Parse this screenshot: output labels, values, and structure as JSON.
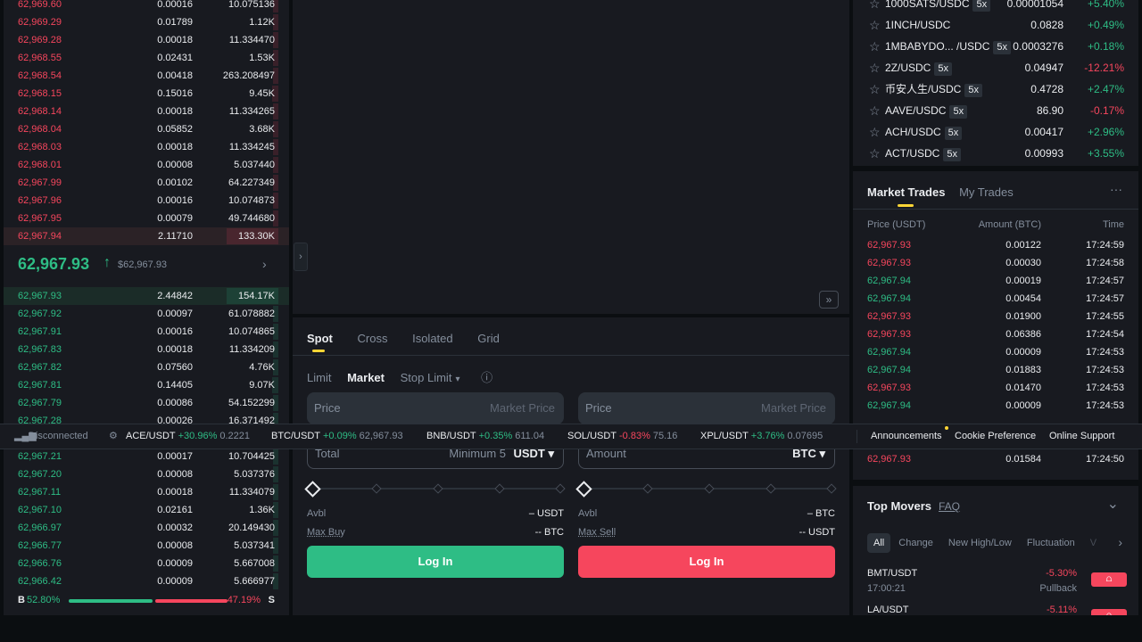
{
  "orderbook": {
    "asks": [
      {
        "price": "62,969.60",
        "amount": "0.00016",
        "total": "10.075136",
        "depth": 0.02
      },
      {
        "price": "62,969.29",
        "amount": "0.01789",
        "total": "1.12K",
        "depth": 0.04
      },
      {
        "price": "62,969.28",
        "amount": "0.00018",
        "total": "11.334470",
        "depth": 0.02
      },
      {
        "price": "62,968.55",
        "amount": "0.02431",
        "total": "1.53K",
        "depth": 0.05
      },
      {
        "price": "62,968.54",
        "amount": "0.00418",
        "total": "263.208497",
        "depth": 0.03
      },
      {
        "price": "62,968.15",
        "amount": "0.15016",
        "total": "9.45K",
        "depth": 0.12
      },
      {
        "price": "62,968.14",
        "amount": "0.00018",
        "total": "11.334265",
        "depth": 0.02
      },
      {
        "price": "62,968.04",
        "amount": "0.05852",
        "total": "3.68K",
        "depth": 0.06
      },
      {
        "price": "62,968.03",
        "amount": "0.00018",
        "total": "11.334245",
        "depth": 0.02
      },
      {
        "price": "62,968.01",
        "amount": "0.00008",
        "total": "5.037440",
        "depth": 0.02
      },
      {
        "price": "62,967.99",
        "amount": "0.00102",
        "total": "64.227349",
        "depth": 0.02
      },
      {
        "price": "62,967.96",
        "amount": "0.00016",
        "total": "10.074873",
        "depth": 0.02
      },
      {
        "price": "62,967.95",
        "amount": "0.00079",
        "total": "49.744680",
        "depth": 0.02
      },
      {
        "price": "62,967.94",
        "amount": "2.11710",
        "total": "133.30K",
        "depth": 1.0
      }
    ],
    "mid_price": "62,967.93",
    "mid_arrow": "↑",
    "mid_sub": "$62,967.93",
    "bids_top": [
      {
        "price": "62,967.93",
        "amount": "2.44842",
        "total": "154.17K",
        "depth": 1.0
      },
      {
        "price": "62,967.92",
        "amount": "0.00097",
        "total": "61.078882",
        "depth": 0.02
      },
      {
        "price": "62,967.91",
        "amount": "0.00016",
        "total": "10.074865",
        "depth": 0.02
      },
      {
        "price": "62,967.83",
        "amount": "0.00018",
        "total": "11.334209",
        "depth": 0.02
      },
      {
        "price": "62,967.82",
        "amount": "0.07560",
        "total": "4.76K",
        "depth": 0.06
      },
      {
        "price": "62,967.81",
        "amount": "0.14405",
        "total": "9.07K",
        "depth": 0.12
      },
      {
        "price": "62,967.79",
        "amount": "0.00086",
        "total": "54.152299",
        "depth": 0.02
      },
      {
        "price": "62,967.28",
        "amount": "0.00026",
        "total": "16.371492",
        "depth": 0.02
      }
    ],
    "bids_bottom": [
      {
        "price": "62,967.21",
        "amount": "0.00017",
        "total": "10.704425",
        "depth": 0.02
      },
      {
        "price": "62,967.20",
        "amount": "0.00008",
        "total": "5.037376",
        "depth": 0.02
      },
      {
        "price": "62,967.11",
        "amount": "0.00018",
        "total": "11.334079",
        "depth": 0.02
      },
      {
        "price": "62,967.10",
        "amount": "0.02161",
        "total": "1.36K",
        "depth": 0.04
      },
      {
        "price": "62,966.97",
        "amount": "0.00032",
        "total": "20.149430",
        "depth": 0.02
      },
      {
        "price": "62,966.77",
        "amount": "0.00008",
        "total": "5.037341",
        "depth": 0.02
      },
      {
        "price": "62,966.76",
        "amount": "0.00009",
        "total": "5.667008",
        "depth": 0.02
      },
      {
        "price": "62,966.42",
        "amount": "0.00009",
        "total": "5.666977",
        "depth": 0.02
      }
    ],
    "buy_label": "B",
    "buy_pct": "52.80%",
    "sell_pct": "47.19%",
    "sell_label": "S",
    "buy_ratio": 0.528
  },
  "chart": {
    "collapse_glyph": "›",
    "expand_glyph": "»"
  },
  "tradeform": {
    "tabs": [
      "Spot",
      "Cross",
      "Isolated",
      "Grid"
    ],
    "order_types": {
      "limit": "Limit",
      "market": "Market",
      "stop": "Stop Limit",
      "stop_caret": "▾",
      "info": "ⓘ"
    },
    "buy": {
      "price_label": "Price",
      "price_value": "Market Price",
      "total_label": "Total",
      "total_hint": "Minimum 5",
      "total_unit": "USDT ▾",
      "avbl_label": "Avbl",
      "avbl_value": "– USDT",
      "max_label": "Max Buy",
      "max_value": "-- BTC",
      "button": "Log In"
    },
    "sell": {
      "price_label": "Price",
      "price_value": "Market Price",
      "amount_label": "Amount",
      "amount_unit": "BTC ▾",
      "avbl_label": "Avbl",
      "avbl_value": "– BTC",
      "max_label": "Max Sell",
      "max_value": "-- USDT",
      "button": "Log In"
    }
  },
  "pairs": [
    {
      "name": "1000SATS/USDC",
      "badge": "5x",
      "price": "0.00001054",
      "change": "+5.40%",
      "up": true
    },
    {
      "name": "1INCH/USDC",
      "badge": "",
      "price": "0.0828",
      "change": "+0.49%",
      "up": true
    },
    {
      "name": "1MBABYDO... /USDC",
      "badge": "5x",
      "price": "0.0003276",
      "change": "+0.18%",
      "up": true
    },
    {
      "name": "2Z/USDC",
      "badge": "5x",
      "price": "0.04947",
      "change": "-12.21%",
      "up": false
    },
    {
      "name": "币安人生/USDC",
      "badge": "5x",
      "price": "0.4728",
      "change": "+2.47%",
      "up": true
    },
    {
      "name": "AAVE/USDC",
      "badge": "5x",
      "price": "86.90",
      "change": "-0.17%",
      "up": false
    },
    {
      "name": "ACH/USDC",
      "badge": "5x",
      "price": "0.00417",
      "change": "+2.96%",
      "up": true
    },
    {
      "name": "ACT/USDC",
      "badge": "5x",
      "price": "0.00993",
      "change": "+3.55%",
      "up": true
    }
  ],
  "trades": {
    "tabs": [
      "Market Trades",
      "My Trades"
    ],
    "more": "···",
    "headers": [
      "Price (USDT)",
      "Amount (BTC)",
      "Time"
    ],
    "rows": [
      {
        "price": "62,967.93",
        "amount": "0.00122",
        "time": "17:24:59",
        "up": false
      },
      {
        "price": "62,967.93",
        "amount": "0.00030",
        "time": "17:24:58",
        "up": false
      },
      {
        "price": "62,967.94",
        "amount": "0.00019",
        "time": "17:24:57",
        "up": true
      },
      {
        "price": "62,967.94",
        "amount": "0.00454",
        "time": "17:24:57",
        "up": true
      },
      {
        "price": "62,967.93",
        "amount": "0.01900",
        "time": "17:24:55",
        "up": false
      },
      {
        "price": "62,967.93",
        "amount": "0.06386",
        "time": "17:24:54",
        "up": false
      },
      {
        "price": "62,967.94",
        "amount": "0.00009",
        "time": "17:24:53",
        "up": true
      },
      {
        "price": "62,967.94",
        "amount": "0.01883",
        "time": "17:24:53",
        "up": true
      },
      {
        "price": "62,967.93",
        "amount": "0.01470",
        "time": "17:24:53",
        "up": false
      },
      {
        "price": "62,967.94",
        "amount": "0.00009",
        "time": "17:24:53",
        "up": true
      }
    ],
    "last_row": {
      "price": "62,967.93",
      "amount": "0.01584",
      "time": "17:24:50",
      "up": false
    }
  },
  "movers": {
    "title": "Top Movers",
    "faq": "FAQ",
    "collapse": "⌄",
    "filters": [
      "All",
      "Change",
      "New High/Low",
      "Fluctuation",
      "V"
    ],
    "next": "›",
    "rows": [
      {
        "pair": "BMT/USDT",
        "time": "17:00:21",
        "change": "-5.30%",
        "note": "Pullback"
      },
      {
        "pair": "LA/USDT",
        "time": "",
        "change": "-5.11%",
        "note": ""
      }
    ]
  },
  "statusbar": {
    "conn": "Disconnected",
    "tickers": [
      {
        "pair": "ACE/USDT",
        "change": "+30.96%",
        "price": "0.2221",
        "up": true
      },
      {
        "pair": "BTC/USDT",
        "change": "+0.09%",
        "price": "62,967.93",
        "up": true
      },
      {
        "pair": "BNB/USDT",
        "change": "+0.35%",
        "price": "611.04",
        "up": true
      },
      {
        "pair": "SOL/USDT",
        "change": "-0.83%",
        "price": "75.16",
        "up": false
      },
      {
        "pair": "XPL/USDT",
        "change": "+3.76%",
        "price": "0.07695",
        "up": true
      }
    ],
    "links": [
      "Announcements",
      "Cookie Preference",
      "Online Support"
    ]
  },
  "colors": {
    "up": "#2ebd85",
    "down": "#f6465d",
    "accent": "#fcd535",
    "panel": "#181a20"
  }
}
